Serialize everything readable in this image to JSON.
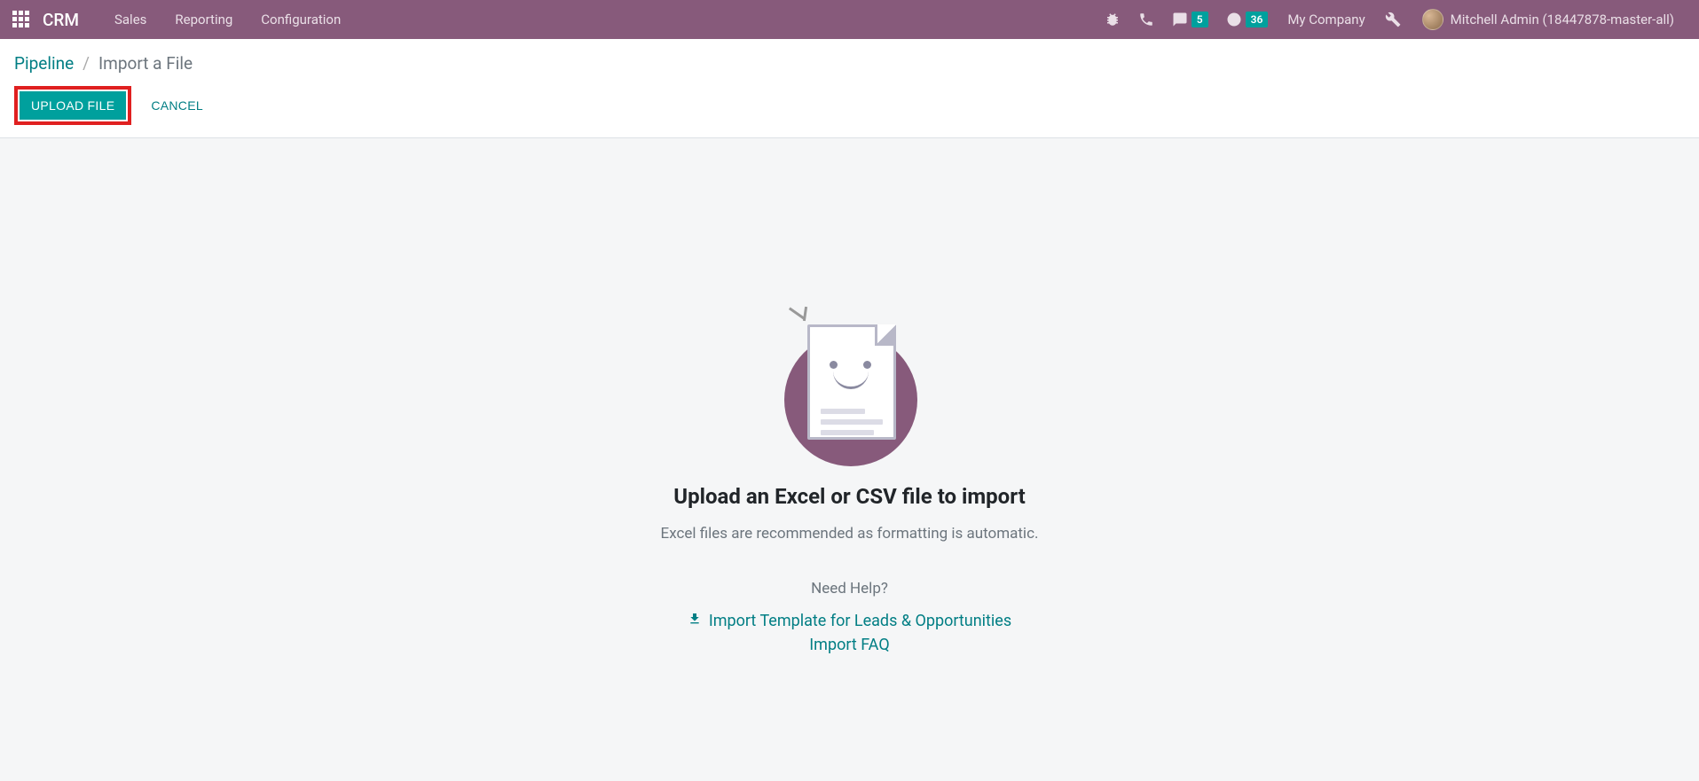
{
  "navbar": {
    "app_name": "CRM",
    "menu": [
      "Sales",
      "Reporting",
      "Configuration"
    ],
    "messages_count": "5",
    "activities_count": "36",
    "company": "My Company",
    "username": "Mitchell Admin (18447878-master-all)"
  },
  "breadcrumb": {
    "parent": "Pipeline",
    "separator": "/",
    "current": "Import a File"
  },
  "buttons": {
    "upload": "UPLOAD FILE",
    "cancel": "CANCEL"
  },
  "empty_state": {
    "title": "Upload an Excel or CSV file to import",
    "subtitle": "Excel files are recommended as formatting is automatic.",
    "help_label": "Need Help?",
    "template_link": "Import Template for Leads & Opportunities",
    "faq_link": "Import FAQ"
  }
}
